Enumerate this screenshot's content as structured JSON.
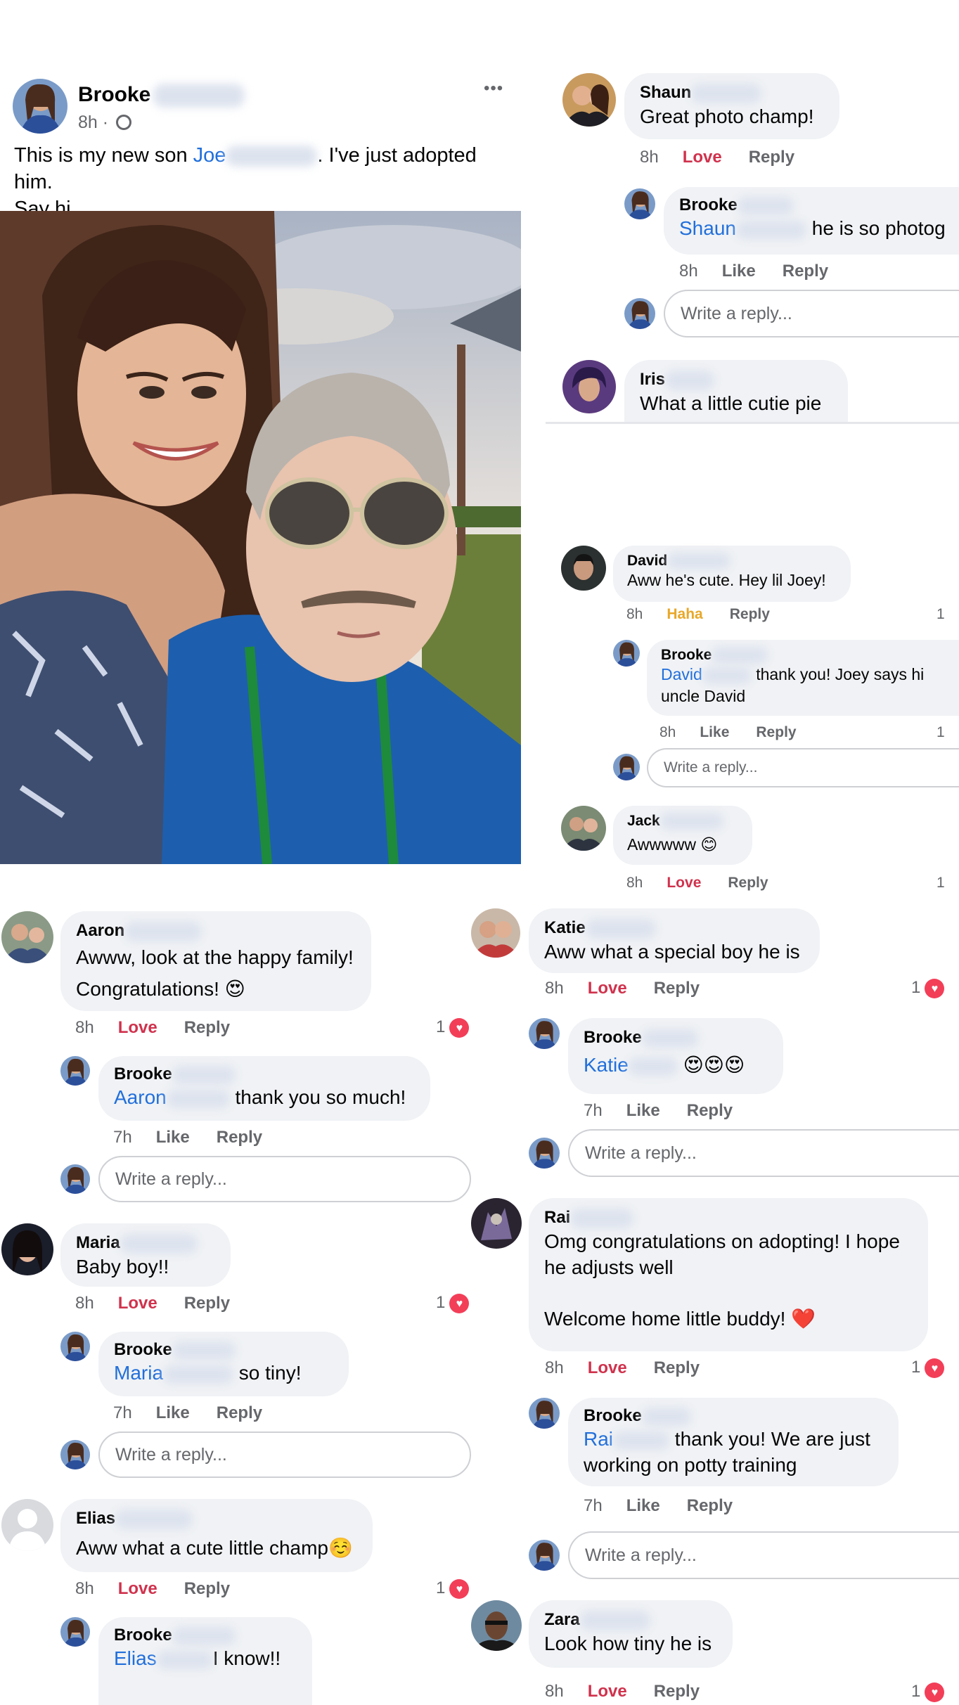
{
  "post": {
    "author": "Brooke",
    "time": "8h ·",
    "menu": "•••",
    "text_before": "This is my new son ",
    "mention": "Joe",
    "text_after": ". I've just adopted him.",
    "text_line2": "Say hi"
  },
  "ui": {
    "love": "Love",
    "like": "Like",
    "haha": "Haha",
    "reply": "Reply",
    "write_reply": "Write a reply..."
  },
  "left_comments": {
    "aaron": {
      "name": "Aaron",
      "line1": "Awww, look at the happy family!",
      "line2": "Congratulations! 😍",
      "time": "8h",
      "count": "1"
    },
    "aaron_reply": {
      "name": "Brooke",
      "mention": "Aaron",
      "text": " thank you so much!",
      "time": "7h"
    },
    "maria": {
      "name": "Maria",
      "text": "Baby boy!!",
      "time": "8h",
      "count": "1"
    },
    "maria_reply": {
      "name": "Brooke",
      "mention": "Maria",
      "text": " so tiny!",
      "time": "7h"
    },
    "elias": {
      "name": "Elias",
      "text": "Aww what a cute little champ☺️",
      "time": "8h",
      "count": "1"
    },
    "elias_reply": {
      "name": "Brooke",
      "mention": "Elias",
      "text": "I know!!"
    }
  },
  "right_top": {
    "shaun": {
      "name": "Shaun",
      "text": "Great photo champ!",
      "time": "8h"
    },
    "shaun_reply": {
      "name": "Brooke",
      "mention": "Shaun",
      "text": " he is so photog",
      "time": "8h"
    },
    "iris": {
      "name": "Iris",
      "text": "What a little cutie pie"
    }
  },
  "right_mid": {
    "david": {
      "name": "David",
      "text": "Aww he's cute. Hey lil Joey!",
      "time": "8h",
      "count": "1"
    },
    "david_reply": {
      "name": "Brooke",
      "mention": "David",
      "text": " thank you! Joey says hi",
      "line2": "uncle David",
      "time": "8h",
      "count": "1"
    },
    "jack": {
      "name": "Jack",
      "text": "Awwwww 😊",
      "time": "8h",
      "count": "1"
    }
  },
  "right_bottom": {
    "katie": {
      "name": "Katie",
      "text": "Aww what a special boy he is",
      "time": "8h",
      "count": "1"
    },
    "katie_reply": {
      "name": "Brooke",
      "mention": "Katie",
      "text": " 😍😍😍",
      "time": "7h"
    },
    "rai": {
      "name": "Rai",
      "line1": "Omg congratulations on adopting! I hope",
      "line2": "he adjusts well",
      "line3": "Welcome home little buddy! ❤️",
      "time": "8h",
      "count": "1"
    },
    "rai_reply": {
      "name": "Brooke",
      "mention": "Rai",
      "text": " thank you! We are just",
      "line2": "working on potty training",
      "time": "7h"
    },
    "zara": {
      "name": "Zara",
      "text": "Look how tiny he is",
      "time": "8h",
      "count": "1"
    }
  },
  "colors": {
    "love": "#d0324d",
    "mention": "#216fdb",
    "bubble": "#f0f2f5",
    "haha": "#e8a829"
  }
}
